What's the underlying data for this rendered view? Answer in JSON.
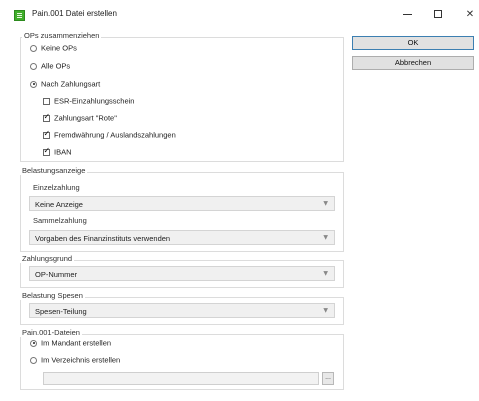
{
  "window": {
    "title": "Pain.001 Datei erstellen"
  },
  "ops_group": {
    "label": "OPs zusammenziehen",
    "radio_none": "Keine OPs",
    "radio_all": "Alle OPs",
    "radio_by_type": "Nach Zahlungsart",
    "selected": "Nach Zahlungsart",
    "checkboxes": [
      {
        "label": "ESR-Einzahlungsschein",
        "checked": false
      },
      {
        "label": "Zahlungsart \"Rote\"",
        "checked": true
      },
      {
        "label": "Fremdwährung / Auslandszahlungen",
        "checked": true
      },
      {
        "label": "IBAN",
        "checked": true
      }
    ]
  },
  "buttons": {
    "ok": "OK",
    "cancel": "Abbrechen"
  },
  "belastung_group": {
    "label": "Belastungsanzeige",
    "einzel_label": "Einzelzahlung",
    "einzel_value": "Keine Anzeige",
    "sammel_label": "Sammelzahlung",
    "sammel_value": "Vorgaben des Finanzinstituts verwenden"
  },
  "zahlungsgrund_group": {
    "label": "Zahlungsgrund",
    "value": "OP-Nummer"
  },
  "spesen_group": {
    "label": "Belastung Spesen",
    "value": "Spesen-Teilung"
  },
  "dateien_group": {
    "label": "Pain.001-Dateien",
    "radio_mandant": "Im Mandant erstellen",
    "radio_verzeichnis": "Im Verzeichnis erstellen",
    "selected": "Im Mandant erstellen",
    "path_value": "",
    "browse_label": "..."
  }
}
